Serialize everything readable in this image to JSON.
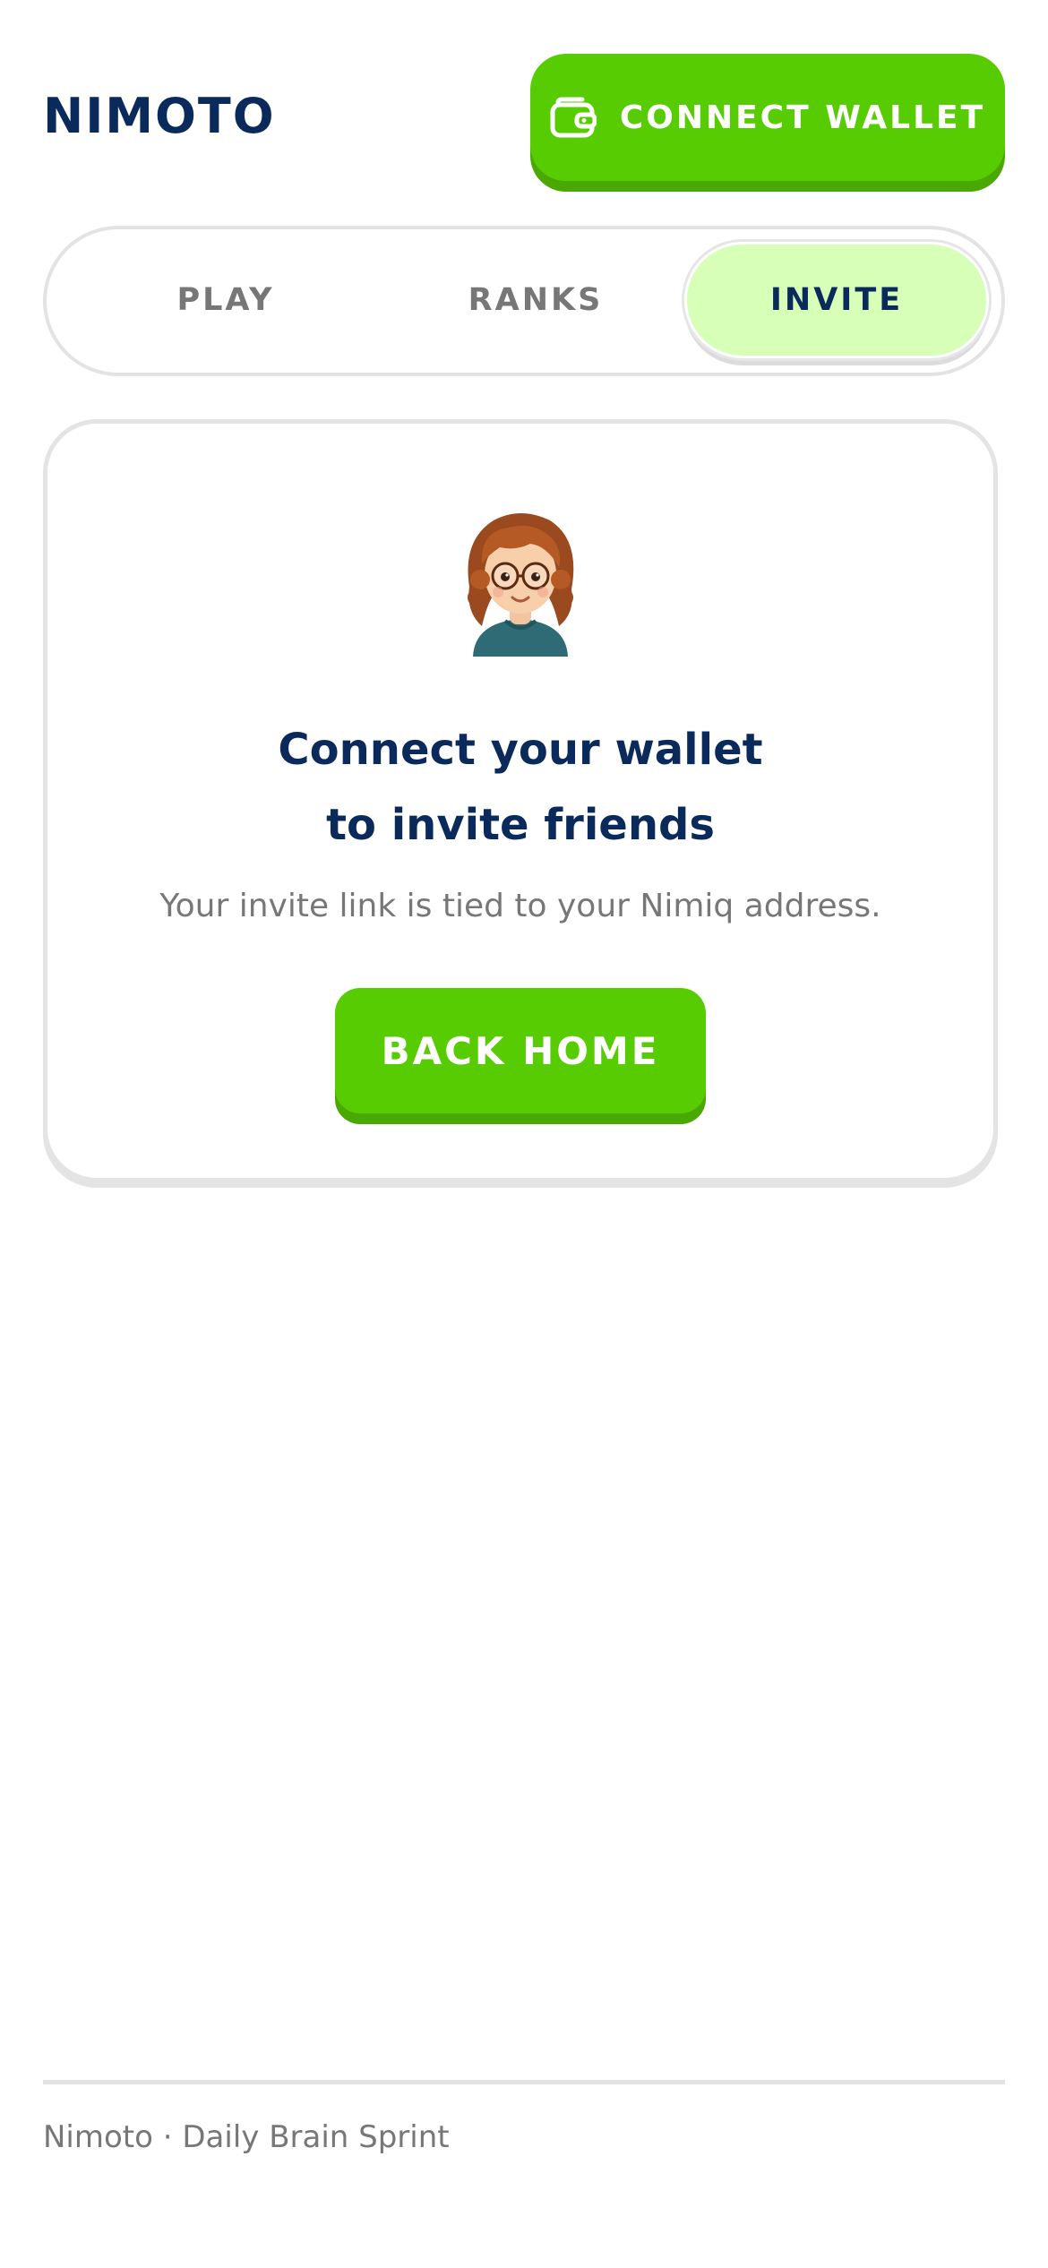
{
  "header": {
    "logo": "NIMOTO",
    "connect_wallet_label": "CONNECT WALLET",
    "wallet_icon": "wallet-icon"
  },
  "tabs": [
    {
      "label": "PLAY",
      "active": false
    },
    {
      "label": "RANKS",
      "active": false
    },
    {
      "label": "INVITE",
      "active": true
    }
  ],
  "card": {
    "avatar_icon": "avatar-girl-glasses",
    "title_line1": "Connect your wallet",
    "title_line2": "to invite friends",
    "subtitle": "Your invite link is tied to your Nimiq address.",
    "button_label": "BACK HOME"
  },
  "footer": {
    "text": "Nimoto · Daily Brain Sprint"
  },
  "colors": {
    "brand_navy": "#0b2a5c",
    "accent_green": "#58cc02",
    "accent_green_dark": "#4aa802",
    "active_tab_bg": "#d7ffb8",
    "muted_text": "#777777",
    "border_gray": "#e3e3e3"
  }
}
